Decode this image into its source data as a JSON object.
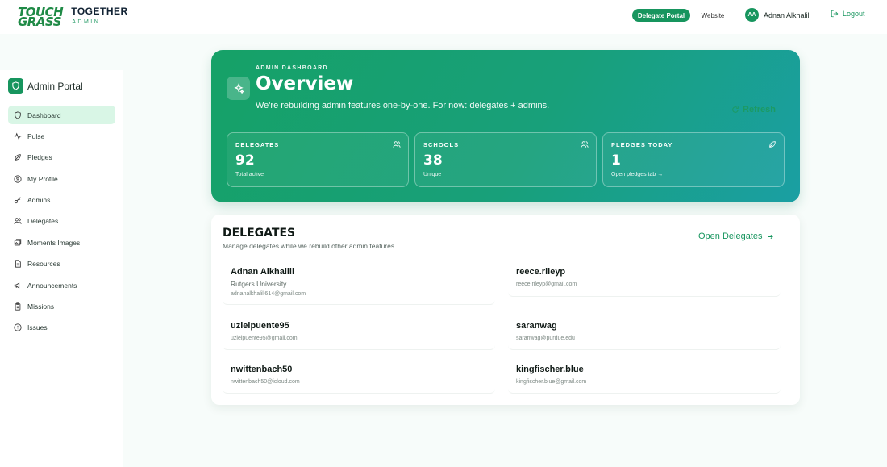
{
  "header": {
    "logo_line1": "TOUCH",
    "logo_line2": "GRASS",
    "brand_title": "TOGETHER",
    "brand_sub": "ADMIN",
    "delegate_portal": "Delegate Portal",
    "website": "Website",
    "user_initials": "AA",
    "user_name": "Adnan Alkhalili",
    "logout": "Logout"
  },
  "sidebar": {
    "title": "Admin Portal",
    "items": [
      {
        "label": "Dashboard",
        "icon": "shield-icon"
      },
      {
        "label": "Pulse",
        "icon": "activity-icon"
      },
      {
        "label": "Pledges",
        "icon": "leaf-icon"
      },
      {
        "label": "My Profile",
        "icon": "user-circle-icon"
      },
      {
        "label": "Admins",
        "icon": "key-icon"
      },
      {
        "label": "Delegates",
        "icon": "users-icon"
      },
      {
        "label": "Moments Images",
        "icon": "images-icon"
      },
      {
        "label": "Resources",
        "icon": "document-icon"
      },
      {
        "label": "Announcements",
        "icon": "megaphone-icon"
      },
      {
        "label": "Missions",
        "icon": "clipboard-icon"
      },
      {
        "label": "Issues",
        "icon": "alert-circle-icon"
      }
    ]
  },
  "hero": {
    "kicker": "ADMIN DASHBOARD",
    "title": "Overview",
    "subtitle": "We're rebuilding admin features one-by-one. For now: delegates + admins.",
    "refresh": "Refresh",
    "stats": [
      {
        "label": "DELEGATES",
        "value": "92",
        "foot": "Total active",
        "icon": "users-icon"
      },
      {
        "label": "SCHOOLS",
        "value": "38",
        "foot": "Unique",
        "icon": "users-icon"
      },
      {
        "label": "PLEDGES TODAY",
        "value": "1",
        "foot": "Open pledges tab →",
        "icon": "leaf-icon"
      }
    ]
  },
  "delegates": {
    "title": "DELEGATES",
    "subtitle": "Manage delegates while we rebuild other admin features.",
    "open_link": "Open Delegates",
    "list": [
      {
        "name": "Adnan Alkhalili",
        "school": "Rutgers University",
        "email": "adnanalkhalili614@gmail.com"
      },
      {
        "name": "reece.rileyp",
        "school": "",
        "email": "reece.rileyp@gmail.com"
      },
      {
        "name": "uzielpuente95",
        "school": "",
        "email": "uzielpuente95@gmail.com"
      },
      {
        "name": "saranwag",
        "school": "",
        "email": "saranwag@purdue.edu"
      },
      {
        "name": "nwittenbach50",
        "school": "",
        "email": "nwittenbach50@icloud.com"
      },
      {
        "name": "kingfischer.blue",
        "school": "",
        "email": "kingfischer.blue@gmail.com"
      }
    ]
  },
  "colors": {
    "accent": "#17955e",
    "active_nav": "#d9f6e6"
  }
}
